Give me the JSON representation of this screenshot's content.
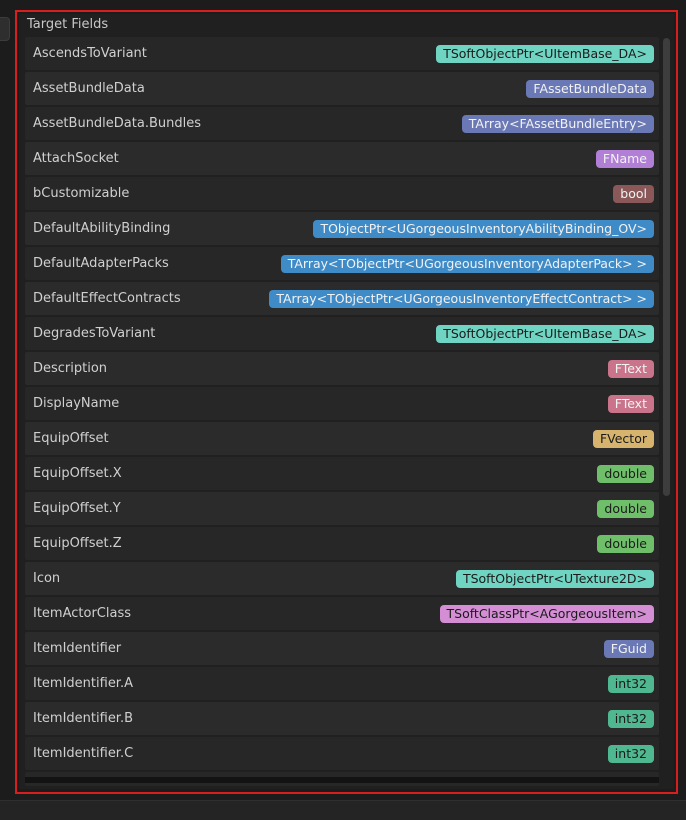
{
  "panel": {
    "title": "Target Fields"
  },
  "fields": [
    {
      "name": "AscendsToVariant",
      "type": "TSoftObjectPtr<UItemBase_DA>",
      "color": "#70d4c3",
      "text_color": "#1b1b1b"
    },
    {
      "name": "AssetBundleData",
      "type": "FAssetBundleData",
      "color": "#6a79b6",
      "text_color": "#f2f2f2"
    },
    {
      "name": "AssetBundleData.Bundles",
      "type": "TArray<FAssetBundleEntry>",
      "color": "#6a79b6",
      "text_color": "#f2f2f2"
    },
    {
      "name": "AttachSocket",
      "type": "FName",
      "color": "#b27fd6",
      "text_color": "#f2f2f2"
    },
    {
      "name": "bCustomizable",
      "type": "bool",
      "color": "#8a5858",
      "text_color": "#f2f2f2"
    },
    {
      "name": "DefaultAbilityBinding",
      "type": "TObjectPtr<UGorgeousInventoryAbilityBinding_OV>",
      "color": "#3f8bc8",
      "text_color": "#f2f2f2"
    },
    {
      "name": "DefaultAdapterPacks",
      "type": "TArray<TObjectPtr<UGorgeousInventoryAdapterPack> >",
      "color": "#3f8bc8",
      "text_color": "#f2f2f2"
    },
    {
      "name": "DefaultEffectContracts",
      "type": "TArray<TObjectPtr<UGorgeousInventoryEffectContract> >",
      "color": "#3f8bc8",
      "text_color": "#f2f2f2"
    },
    {
      "name": "DegradesToVariant",
      "type": "TSoftObjectPtr<UItemBase_DA>",
      "color": "#70d4c3",
      "text_color": "#1b1b1b"
    },
    {
      "name": "Description",
      "type": "FText",
      "color": "#c9748a",
      "text_color": "#f2f2f2"
    },
    {
      "name": "DisplayName",
      "type": "FText",
      "color": "#c9748a",
      "text_color": "#f2f2f2"
    },
    {
      "name": "EquipOffset",
      "type": "FVector",
      "color": "#d7b46e",
      "text_color": "#1b1b1b"
    },
    {
      "name": "EquipOffset.X",
      "type": "double",
      "color": "#6fbf6a",
      "text_color": "#1b1b1b"
    },
    {
      "name": "EquipOffset.Y",
      "type": "double",
      "color": "#6fbf6a",
      "text_color": "#1b1b1b"
    },
    {
      "name": "EquipOffset.Z",
      "type": "double",
      "color": "#6fbf6a",
      "text_color": "#1b1b1b"
    },
    {
      "name": "Icon",
      "type": "TSoftObjectPtr<UTexture2D>",
      "color": "#70d4c3",
      "text_color": "#1b1b1b"
    },
    {
      "name": "ItemActorClass",
      "type": "TSoftClassPtr<AGorgeousItem>",
      "color": "#d48ed4",
      "text_color": "#1b1b1b"
    },
    {
      "name": "ItemIdentifier",
      "type": "FGuid",
      "color": "#6a79b6",
      "text_color": "#f2f2f2"
    },
    {
      "name": "ItemIdentifier.A",
      "type": "int32",
      "color": "#4fb890",
      "text_color": "#1b1b1b"
    },
    {
      "name": "ItemIdentifier.B",
      "type": "int32",
      "color": "#4fb890",
      "text_color": "#1b1b1b"
    },
    {
      "name": "ItemIdentifier.C",
      "type": "int32",
      "color": "#4fb890",
      "text_color": "#1b1b1b"
    }
  ],
  "colors": {
    "highlight_frame": "#d91e1e",
    "panel_bg": "#202020",
    "row_odd": "#272727",
    "row_even": "#2b2b2b"
  }
}
